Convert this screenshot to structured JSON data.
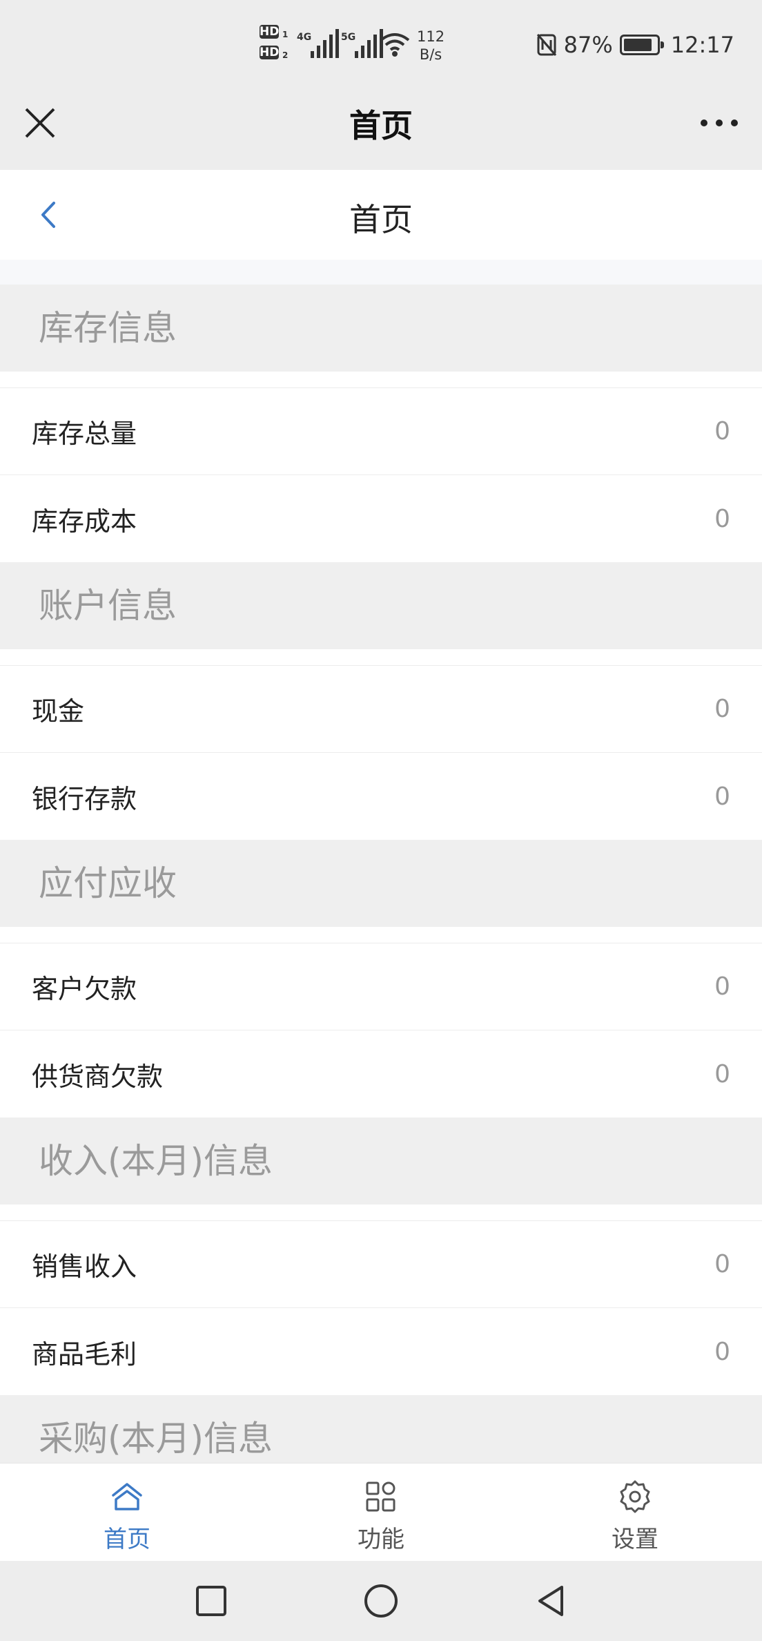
{
  "status_bar": {
    "hd1": "HD",
    "hd1_sub": "1",
    "hd2": "HD",
    "hd2_sub": "2",
    "net_4g": "4G",
    "net_5g": "5G",
    "speed_value": "112",
    "speed_unit": "B/s",
    "battery": "87%",
    "battery_level": 0.87,
    "time": "12:17"
  },
  "wechat_bar": {
    "title": "首页"
  },
  "nav_bar": {
    "title": "首页"
  },
  "sections": [
    {
      "title": "库存信息",
      "rows": [
        {
          "label": "库存总量",
          "value": "0"
        },
        {
          "label": "库存成本",
          "value": "0"
        }
      ]
    },
    {
      "title": "账户信息",
      "rows": [
        {
          "label": "现金",
          "value": "0"
        },
        {
          "label": "银行存款",
          "value": "0"
        }
      ]
    },
    {
      "title": "应付应收",
      "rows": [
        {
          "label": "客户欠款",
          "value": "0"
        },
        {
          "label": "供货商欠款",
          "value": "0"
        }
      ]
    },
    {
      "title": "收入(本月)信息",
      "rows": [
        {
          "label": "销售收入",
          "value": "0"
        },
        {
          "label": "商品毛利",
          "value": "0"
        }
      ]
    },
    {
      "title": "采购(本月)信息",
      "rows": []
    }
  ],
  "tab_bar": {
    "tabs": [
      {
        "label": "首页",
        "icon": "home-icon",
        "active": true
      },
      {
        "label": "功能",
        "icon": "grid-icon",
        "active": false
      },
      {
        "label": "设置",
        "icon": "gear-icon",
        "active": false
      }
    ]
  },
  "colors": {
    "accent": "#3d7ac6",
    "section_bg": "#efefef",
    "section_text": "#9a9a9a"
  }
}
